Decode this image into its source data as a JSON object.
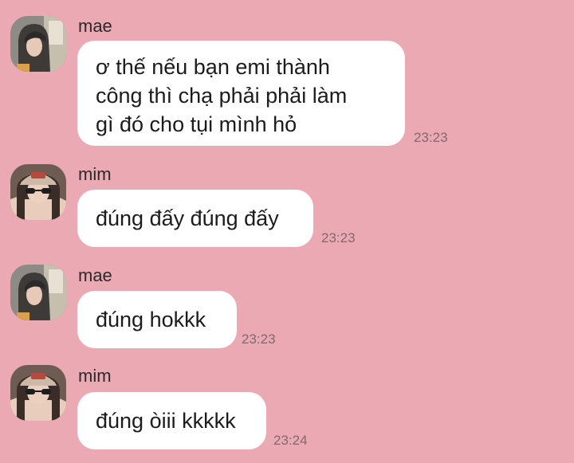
{
  "messages": [
    {
      "sender": "mae",
      "avatar": "mae-avatar",
      "lines": [
        "ơ thế nếu bạn emi thành",
        "công thì chạ phải phải làm",
        "gì đó cho tụi mình hỏ"
      ],
      "time": "23:23"
    },
    {
      "sender": "mim",
      "avatar": "mim-avatar",
      "lines": [
        "đúng đấy đúng đấy"
      ],
      "time": "23:23"
    },
    {
      "sender": "mae",
      "avatar": "mae-avatar",
      "lines": [
        "đúng hokkk"
      ],
      "time": "23:23"
    },
    {
      "sender": "mim",
      "avatar": "mim-avatar",
      "lines": [
        "đúng òiii kkkkk"
      ],
      "time": "23:24"
    }
  ],
  "colors": {
    "background": "#eba9b4",
    "bubble": "#ffffff",
    "text": "#1c1c1c",
    "timestamp": "#7f6a6e"
  }
}
